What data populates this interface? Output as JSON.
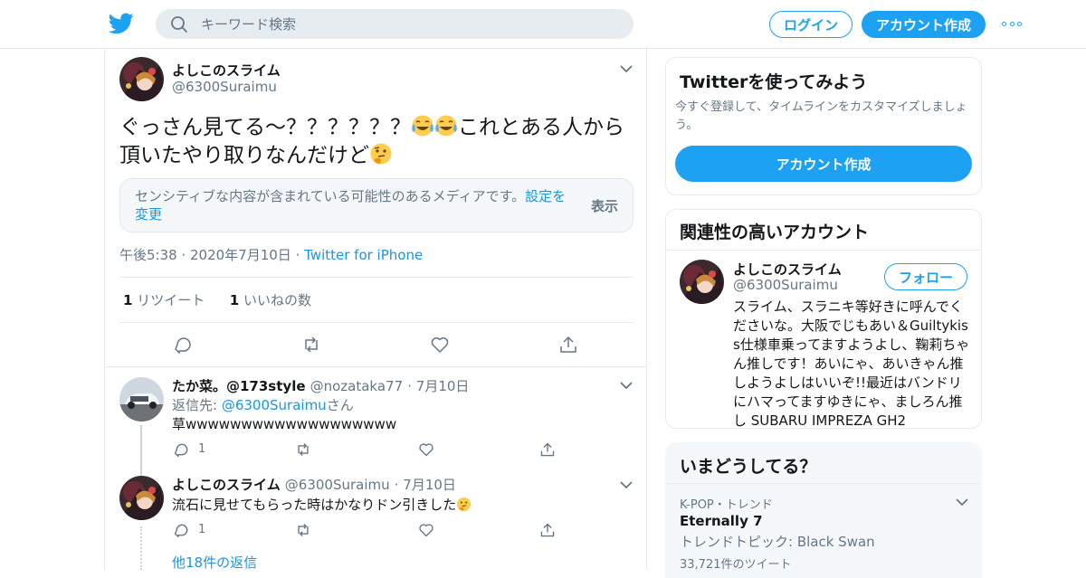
{
  "search": {
    "placeholder": "キーワード検索"
  },
  "header": {
    "login": "ログイン",
    "signup": "アカウント作成"
  },
  "tweet": {
    "author_name": "よしこのスライム",
    "author_handle": "@6300Suraimu",
    "text_part1": "ぐっさん見てる～？？？？？？",
    "text_part2": "これとある人から頂いたやり取りなんだけど",
    "sensitive_msg": "センシティブな内容が含まれている可能性のあるメディアです。",
    "sensitive_link": "設定を変更",
    "sensitive_show": "表示",
    "time": "午後5:38",
    "date": "2020年7月10日",
    "source": "Twitter for iPhone",
    "retweets": "1",
    "retweets_label": "リツイート",
    "likes": "1",
    "likes_label": "いいねの数"
  },
  "replies": [
    {
      "name": "たか菜。@173style",
      "handle": "@nozataka77",
      "date": "7月10日",
      "reply_to_prefix": "返信先:",
      "reply_to": "@6300Suraimu",
      "reply_to_suffix": "さん",
      "text": "草wwwwwwwwwwwwwwwwwww",
      "reply_count": "1"
    },
    {
      "name": "よしこのスライム",
      "handle": "@6300Suraimu",
      "date": "7月10日",
      "text": "流石に見せてもらった時はかなりドン引きした",
      "reply_count": "1"
    }
  ],
  "more_replies": "他18件の返信",
  "side": {
    "try": {
      "title": "Twitterを使ってみよう",
      "desc": "今すぐ登録して、タイムラインをカスタマイズしましょう。",
      "button": "アカウント作成"
    },
    "related": {
      "title": "関連性の高いアカウント",
      "name": "よしこのスライム",
      "handle": "@6300Suraimu",
      "follow": "フォロー",
      "bio": "スライム、スラニキ等好きに呼んでくださいな。大阪でじもあい＆Guiltykiss仕様車乗ってますようよし、鞠莉ちゃん推しです！あいにゃ、あいきゃん推しようよしはいいぞ!!最近はバンドリにハマってますゆきにゃ、ましろん推し SUBARU IMPREZA GH2"
    },
    "trends": {
      "title": "いまどうしてる？",
      "context": "K-POP・トレンド",
      "name": "Eternally 7",
      "topic": "トレンドトピック: Black Swan",
      "count": "33,721件のツイート"
    }
  },
  "colors": {
    "accent": "#1da1f2",
    "link": "#1b95e0",
    "muted": "#657786",
    "border": "#e6ecf0"
  }
}
